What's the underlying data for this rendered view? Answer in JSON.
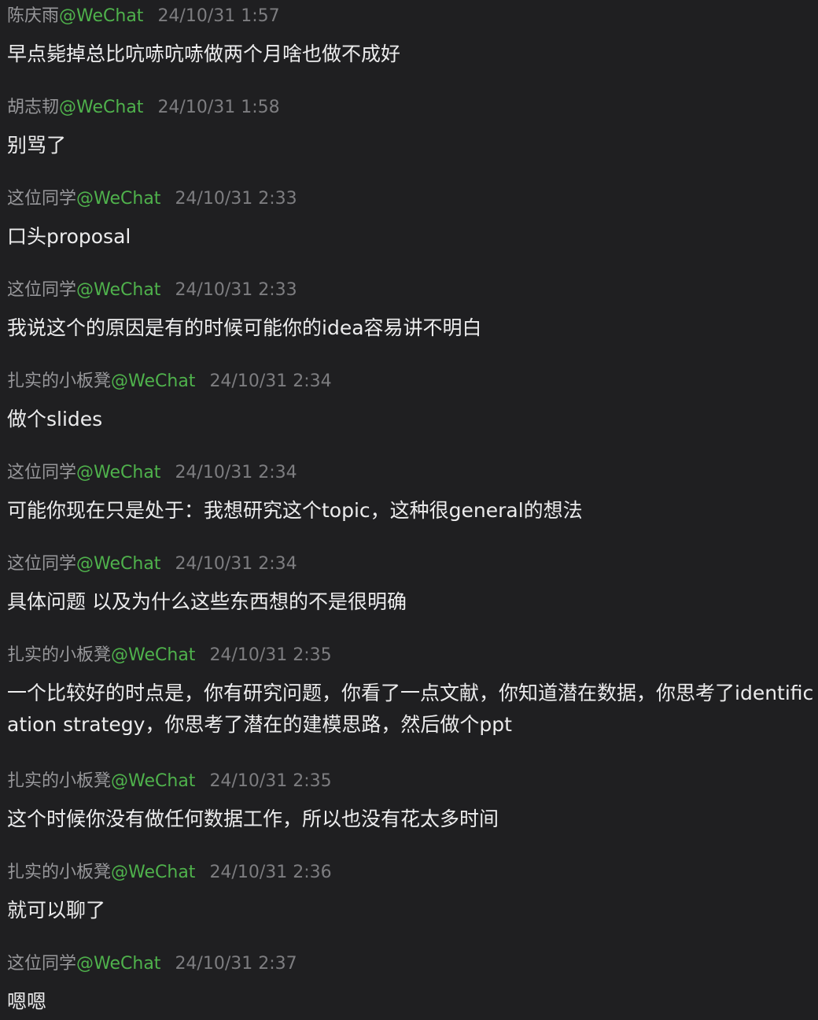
{
  "messages": [
    {
      "sender": "陈庆雨",
      "platform": "@WeChat",
      "time": "24/10/31 1:57",
      "text": "早点毙掉总比吭哧吭哧做两个月啥也做不成好"
    },
    {
      "sender": "胡志韧",
      "platform": "@WeChat",
      "time": "24/10/31 1:58",
      "text": "别骂了"
    },
    {
      "sender": "这位同学",
      "platform": "@WeChat",
      "time": "24/10/31 2:33",
      "text": "口头proposal"
    },
    {
      "sender": "这位同学",
      "platform": "@WeChat",
      "time": "24/10/31 2:33",
      "text": "我说这个的原因是有的时候可能你的idea容易讲不明白"
    },
    {
      "sender": "扎实的小板凳",
      "platform": "@WeChat",
      "time": "24/10/31 2:34",
      "text": "做个slides"
    },
    {
      "sender": "这位同学",
      "platform": "@WeChat",
      "time": "24/10/31 2:34",
      "text": "可能你现在只是处于：我想研究这个topic，这种很general的想法"
    },
    {
      "sender": "这位同学",
      "platform": "@WeChat",
      "time": "24/10/31 2:34",
      "text": "具体问题 以及为什么这些东西想的不是很明确"
    },
    {
      "sender": "扎实的小板凳",
      "platform": "@WeChat",
      "time": "24/10/31 2:35",
      "text": "一个比较好的时点是，你有研究问题，你看了一点文献，你知道潜在数据，你思考了identification strategy，你思考了潜在的建模思路，然后做个ppt"
    },
    {
      "sender": "扎实的小板凳",
      "platform": "@WeChat",
      "time": "24/10/31 2:35",
      "text": "这个时候你没有做任何数据工作，所以也没有花太多时间"
    },
    {
      "sender": "扎实的小板凳",
      "platform": "@WeChat",
      "time": "24/10/31 2:36",
      "text": "就可以聊了"
    },
    {
      "sender": "这位同学",
      "platform": "@WeChat",
      "time": "24/10/31 2:37",
      "text": "嗯嗯"
    }
  ],
  "colors": {
    "background": "#1f1f21",
    "sender_name": "#97979a",
    "platform_tag": "#4fb24c",
    "timestamp": "#7d7d80",
    "message_text": "#ececed"
  }
}
